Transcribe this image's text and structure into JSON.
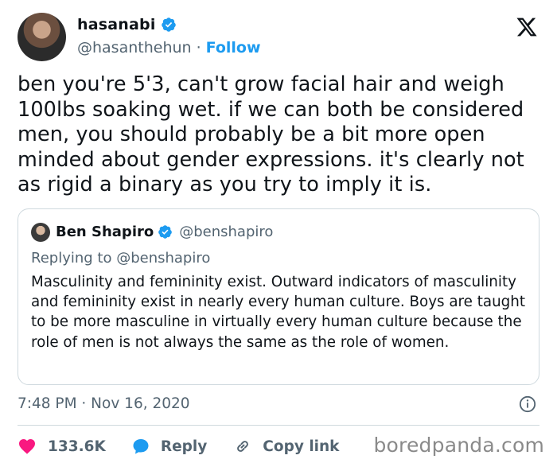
{
  "tweet": {
    "author_name": "hasanabi",
    "author_handle": "@hasanthehun",
    "separator": "·",
    "follow_label": "Follow",
    "text": "ben you're 5'3, can't grow facial hair and weigh\n100lbs soaking wet. if we can both be considered\nmen, you should probably be a bit more open\nminded about gender expressions. it's clearly not\nas rigid a binary as you try to imply it is.",
    "time": "7:48 PM · Nov 16, 2020",
    "like_count": "133.6K",
    "reply_label": "Reply",
    "copy_label": "Copy link"
  },
  "quoted": {
    "author_name": "Ben Shapiro",
    "author_handle": "@benshapiro",
    "replying_to": "Replying to @benshapiro",
    "text": "Masculinity and femininity exist. Outward indicators of masculinity and femininity exist in nearly every human culture. Boys are taught to be more masculine in virtually every human culture because the role of men is not always the same as the role of women."
  },
  "watermark": "boredpanda.com",
  "icons": {
    "verified": "verified-badge-icon",
    "platform": "x-logo-icon",
    "info": "info-icon",
    "like": "heart-icon",
    "reply": "reply-bubble-icon",
    "copy": "link-icon"
  },
  "colors": {
    "accent": "#1d9bf0",
    "like": "#f91880",
    "text": "#0f1419",
    "muted": "#536471",
    "border": "#cfd9de"
  }
}
